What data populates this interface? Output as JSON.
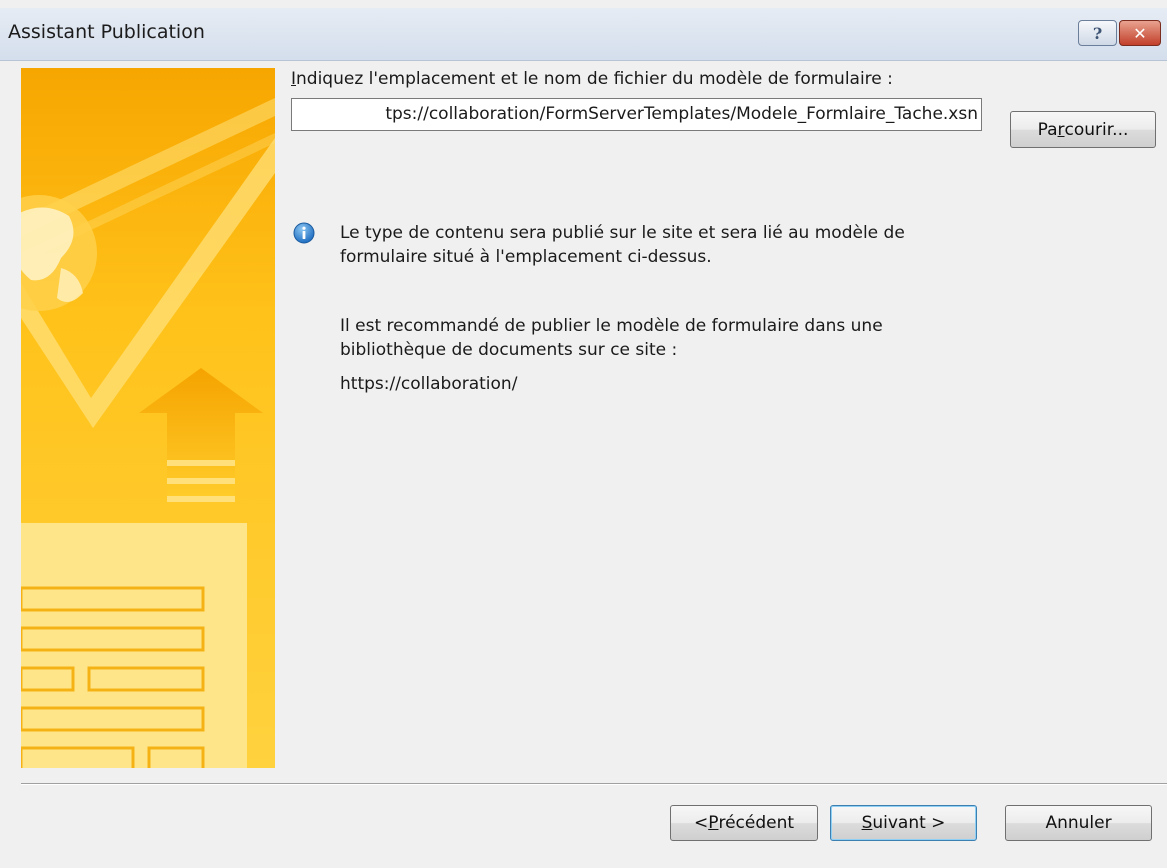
{
  "window": {
    "title": "Assistant Publication",
    "help_glyph": "?",
    "close_glyph": "✕"
  },
  "location": {
    "label_first": "I",
    "label_rest": "ndiquez l'emplacement et le nom de fichier du modèle de formulaire :",
    "value": "tps://collaboration/FormServerTemplates/Modele_Formlaire_Tache.xsn",
    "browse_pre": "Pa",
    "browse_key": "r",
    "browse_post": "courir..."
  },
  "info": {
    "icon": "info-icon",
    "line1": "Le type de contenu sera publié sur le site et sera lié au modèle de",
    "line2": "formulaire situé à l'emplacement ci-dessus.",
    "line3": "Il est recommandé de publier le modèle de formulaire dans une",
    "line4": "bibliothèque de documents sur ce site :",
    "url": "https://collaboration/"
  },
  "footer": {
    "prev_pre": "< ",
    "prev_key": "P",
    "prev_post": "récédent",
    "next_key": "S",
    "next_post": "uivant >",
    "cancel_label": "Annuler"
  },
  "colors": {
    "banner_light": "#ffd64a",
    "banner_dark": "#f7a800",
    "accent_blue": "#3c7fb1"
  }
}
